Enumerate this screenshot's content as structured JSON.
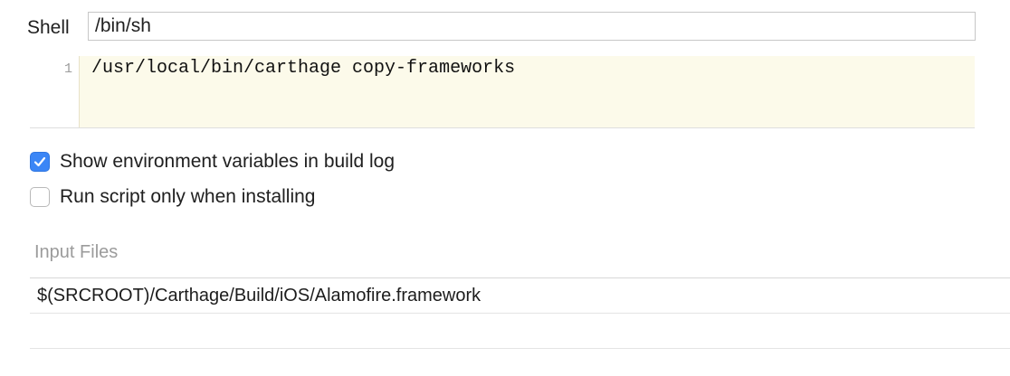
{
  "shell": {
    "label": "Shell",
    "value": "/bin/sh"
  },
  "script_editor": {
    "lines": [
      {
        "number": "1",
        "code": "/usr/local/bin/carthage copy-frameworks"
      }
    ],
    "background_color": "#fcfaea"
  },
  "options": {
    "show_env_vars": {
      "label": "Show environment variables in build log",
      "checked": true
    },
    "run_only_installing": {
      "label": "Run script only when installing",
      "checked": false
    }
  },
  "input_files": {
    "title": "Input Files",
    "items": [
      "$(SRCROOT)/Carthage/Build/iOS/Alamofire.framework"
    ]
  },
  "colors": {
    "accent": "#3b86f6",
    "muted_text": "#9b9b9b"
  }
}
